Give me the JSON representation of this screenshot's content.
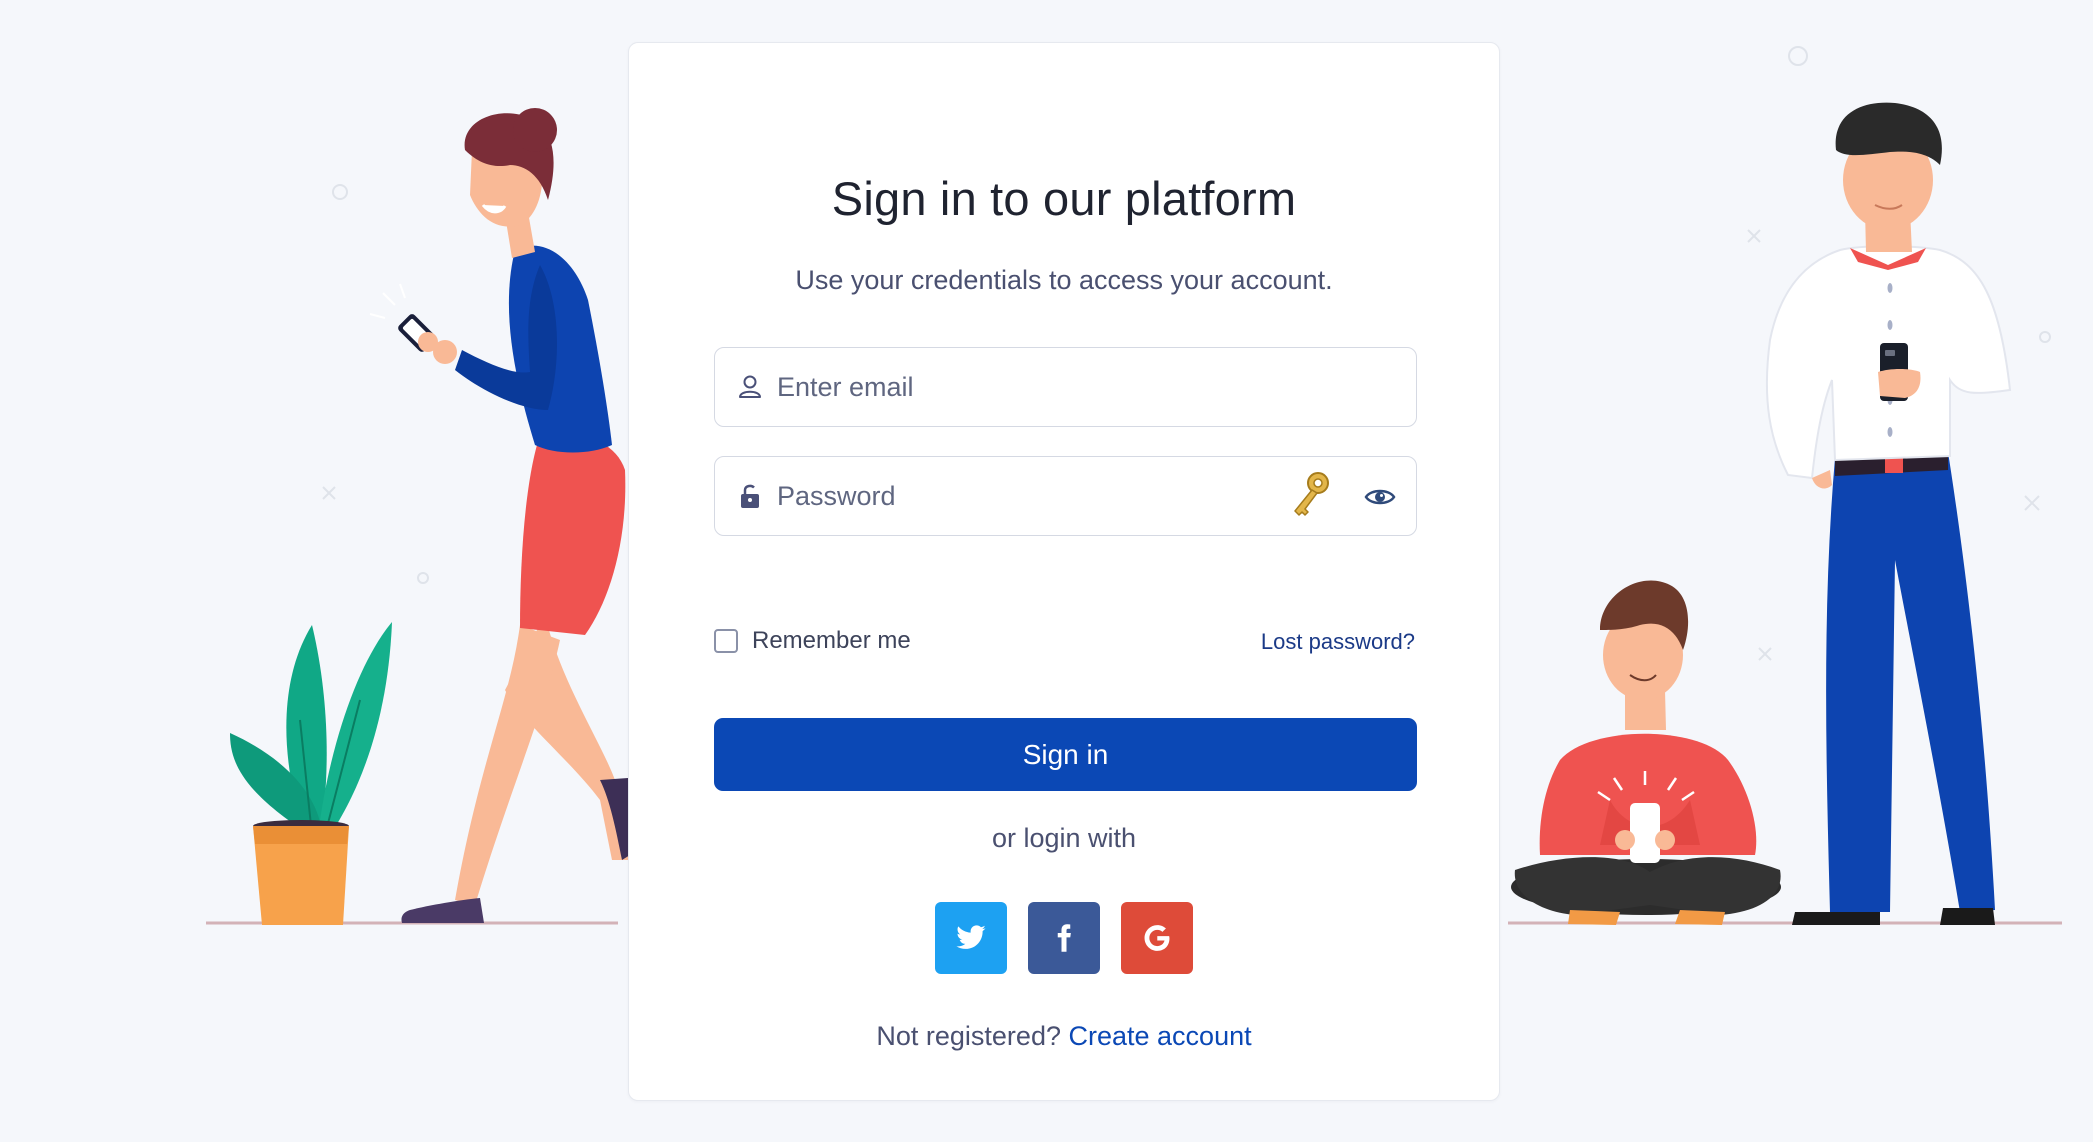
{
  "login": {
    "title": "Sign in to our platform",
    "subtitle": "Use your credentials to access your account.",
    "email_placeholder": "Enter email",
    "password_placeholder": "Password",
    "remember_label": "Remember me",
    "lost_password_label": "Lost password?",
    "signin_label": "Sign in",
    "or_login_with": "or login with",
    "social_buttons": [
      "twitter-icon",
      "facebook-icon",
      "google-icon"
    ],
    "not_registered_text": "Not registered?",
    "create_account_label": "Create account"
  },
  "colors": {
    "primary": "#0b48b5",
    "twitter": "#1da1f2",
    "facebook": "#3b5998",
    "google": "#de4b39",
    "background": "#f5f7fb"
  }
}
